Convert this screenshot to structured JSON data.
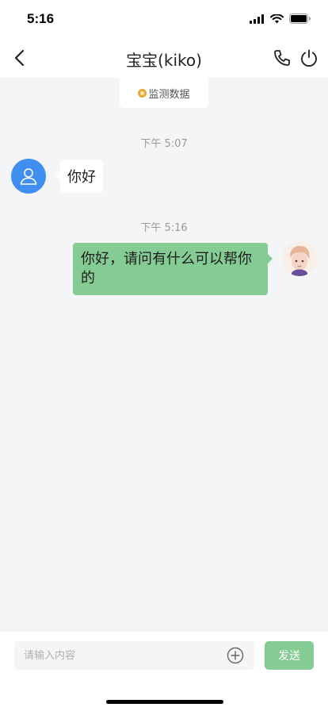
{
  "status_bar": {
    "time": "5:16"
  },
  "nav": {
    "title": "宝宝(kiko)"
  },
  "monitor": {
    "label": "监测数据"
  },
  "messages": [
    {
      "timestamp": "下午 5:07",
      "side": "left",
      "text": "你好"
    },
    {
      "timestamp": "下午 5:16",
      "side": "right",
      "text": "你好，请问有什么可以帮你的"
    }
  ],
  "input_bar": {
    "placeholder": "请输入内容",
    "send_label": "发送"
  },
  "colors": {
    "accent_green": "#85cb94",
    "avatar_blue": "#3f8ef0",
    "background": "#f4f5f7"
  },
  "icons": [
    "back-icon",
    "phone-icon",
    "power-icon",
    "user-icon",
    "add-circle-icon",
    "signal-icon",
    "wifi-icon",
    "battery-icon"
  ]
}
